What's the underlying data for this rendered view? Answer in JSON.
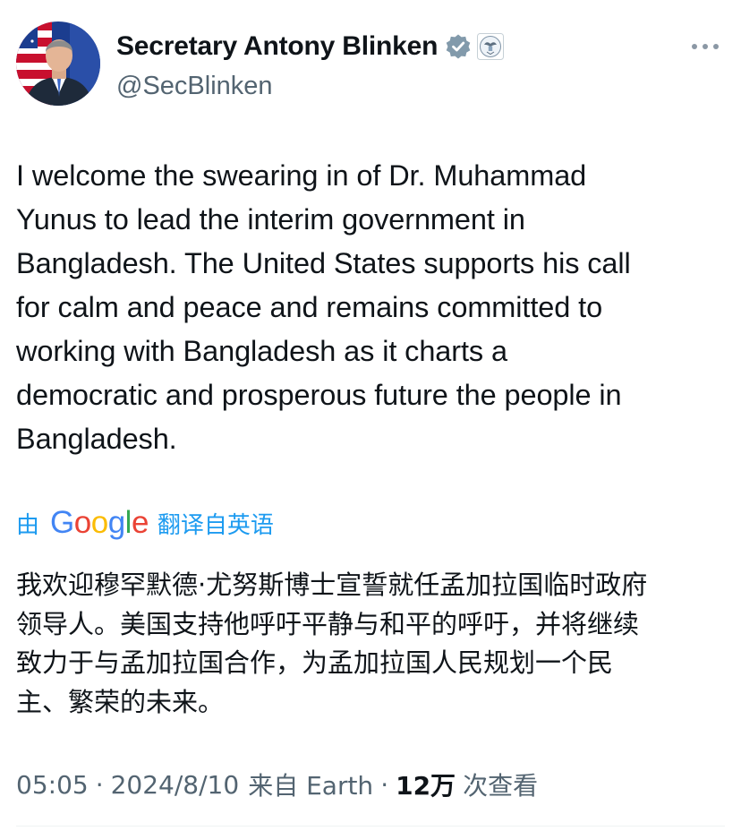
{
  "author": {
    "display_name": "Secretary Antony Blinken",
    "handle": "@SecBlinken",
    "verified_badge_icon": "verified-badge-icon",
    "affiliate_icon": "us-government-seal-icon"
  },
  "tweet": {
    "text": "I welcome the swearing in of Dr. Muhammad\nYunus to lead the interim government in\nBangladesh. The United States supports his call\nfor calm and peace and remains committed to\nworking with Bangladesh as it charts a\ndemocratic and prosperous future the people in\nBangladesh."
  },
  "translation": {
    "prefix": "由",
    "provider": "Google",
    "label": "翻译自英语",
    "text": "我欢迎穆罕默德·尤努斯博士宣誓就任孟加拉国临时政府\n领导人。美国支持他呼吁平静与和平的呼吁，并将继续\n致力于与孟加拉国合作，为孟加拉国人民规划一个民\n主、繁荣的未来。"
  },
  "meta": {
    "time": "05:05",
    "separator": "·",
    "date": "2024/8/10",
    "source": "来自 Earth",
    "views_count": "12万",
    "views_label": "次查看"
  },
  "colors": {
    "accent": "#1d9bf0",
    "text": "#0f1419",
    "muted": "#536471",
    "google_blue": "#4285f4",
    "google_red": "#ea4335",
    "google_yellow": "#fbbc05",
    "google_green": "#34a853"
  }
}
